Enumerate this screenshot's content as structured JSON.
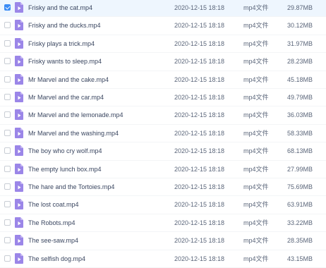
{
  "files": [
    {
      "name": "Frisky and the cat.mp4",
      "date": "2020-12-15 18:18",
      "type": "mp4文件",
      "size": "29.87MB",
      "checked": true
    },
    {
      "name": "Frisky and the ducks.mp4",
      "date": "2020-12-15 18:18",
      "type": "mp4文件",
      "size": "30.12MB",
      "checked": false
    },
    {
      "name": "Frisky plays a trick.mp4",
      "date": "2020-12-15 18:18",
      "type": "mp4文件",
      "size": "31.97MB",
      "checked": false
    },
    {
      "name": "Frisky wants to sleep.mp4",
      "date": "2020-12-15 18:18",
      "type": "mp4文件",
      "size": "28.23MB",
      "checked": false
    },
    {
      "name": "Mr Marvel and the cake.mp4",
      "date": "2020-12-15 18:18",
      "type": "mp4文件",
      "size": "45.18MB",
      "checked": false
    },
    {
      "name": "Mr Marvel and the car.mp4",
      "date": "2020-12-15 18:18",
      "type": "mp4文件",
      "size": "49.79MB",
      "checked": false
    },
    {
      "name": "Mr Marvel and the lemonade.mp4",
      "date": "2020-12-15 18:18",
      "type": "mp4文件",
      "size": "36.03MB",
      "checked": false
    },
    {
      "name": "Mr Marvel and the washing.mp4",
      "date": "2020-12-15 18:18",
      "type": "mp4文件",
      "size": "58.33MB",
      "checked": false
    },
    {
      "name": "The boy who cry wolf.mp4",
      "date": "2020-12-15 18:18",
      "type": "mp4文件",
      "size": "68.13MB",
      "checked": false
    },
    {
      "name": "The empty lunch box.mp4",
      "date": "2020-12-15 18:18",
      "type": "mp4文件",
      "size": "27.99MB",
      "checked": false
    },
    {
      "name": "The hare and the Tortoies.mp4",
      "date": "2020-12-15 18:18",
      "type": "mp4文件",
      "size": "75.69MB",
      "checked": false
    },
    {
      "name": "The lost coat.mp4",
      "date": "2020-12-15 18:18",
      "type": "mp4文件",
      "size": "63.91MB",
      "checked": false
    },
    {
      "name": "The Robots.mp4",
      "date": "2020-12-15 18:18",
      "type": "mp4文件",
      "size": "33.22MB",
      "checked": false
    },
    {
      "name": "The see-saw.mp4",
      "date": "2020-12-15 18:18",
      "type": "mp4文件",
      "size": "28.35MB",
      "checked": false
    },
    {
      "name": "The selfish dog.mp4",
      "date": "2020-12-15 18:18",
      "type": "mp4文件",
      "size": "43.15MB",
      "checked": false
    }
  ],
  "icon": "video-file-icon",
  "colors": {
    "accent": "#3b8cf5",
    "icon": "#9b86e8",
    "selected_row": "#eef6fe"
  }
}
